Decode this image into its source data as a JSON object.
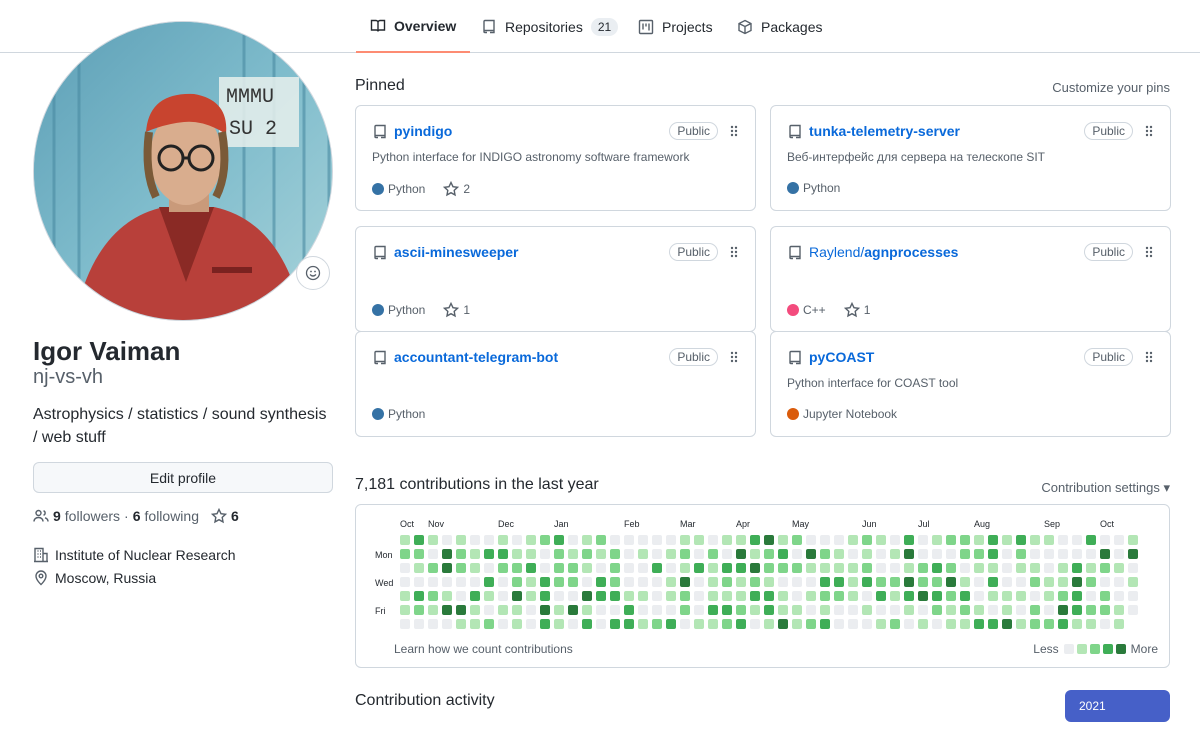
{
  "tabs": [
    {
      "label": "Overview",
      "icon": "book-icon",
      "active": true
    },
    {
      "label": "Repositories",
      "icon": "repo-icon",
      "count": "21"
    },
    {
      "label": "Projects",
      "icon": "project-icon"
    },
    {
      "label": "Packages",
      "icon": "package-icon"
    }
  ],
  "profile": {
    "name": "Igor Vaiman",
    "login": "nj-vs-vh",
    "bio": "Astrophysics / statistics / sound synthesis / web stuff",
    "edit_label": "Edit profile",
    "followers_count": "9",
    "followers_label": "followers",
    "separator": "·",
    "following_count": "6",
    "following_label": "following",
    "stars_count": "6",
    "organization": "Institute of Nuclear Research",
    "location": "Moscow, Russia"
  },
  "pinned": {
    "title": "Pinned",
    "customize": "Customize your pins",
    "cards": [
      {
        "owner": "",
        "name": "pyindigo",
        "badge": "Public",
        "desc": "Python interface for INDIGO astronomy software framework",
        "lang": "Python",
        "lang_color": "#3572A5",
        "stars": "2"
      },
      {
        "owner": "",
        "name": "tunka-telemetry-server",
        "badge": "Public",
        "desc": "Веб-интерфейс для сервера на телескопе SIT",
        "lang": "Python",
        "lang_color": "#3572A5",
        "stars": ""
      },
      {
        "owner": "",
        "name": "ascii-minesweeper",
        "badge": "Public",
        "desc": "",
        "lang": "Python",
        "lang_color": "#3572A5",
        "stars": "1"
      },
      {
        "owner": "Raylend/",
        "name": "agnprocesses",
        "badge": "Public",
        "desc": "",
        "lang": "C++",
        "lang_color": "#f34b7d",
        "stars": "1"
      },
      {
        "owner": "",
        "name": "accountant-telegram-bot",
        "badge": "Public",
        "desc": "",
        "lang": "Python",
        "lang_color": "#3572A5",
        "stars": ""
      },
      {
        "owner": "",
        "name": "pyCOAST",
        "badge": "Public",
        "desc": "Python interface for COAST tool",
        "lang": "Jupyter Notebook",
        "lang_color": "#DA5B0B",
        "stars": ""
      }
    ]
  },
  "contributions": {
    "title": "7,181 contributions in the last year",
    "settings": "Contribution settings ▾",
    "months": [
      "Oct",
      "Nov",
      "Dec",
      "Jan",
      "Feb",
      "Mar",
      "Apr",
      "May",
      "Jun",
      "Jul",
      "Aug",
      "Sep",
      "Oct"
    ],
    "month_week_index": [
      0,
      2,
      7,
      11,
      16,
      20,
      24,
      28,
      33,
      37,
      41,
      46,
      50
    ],
    "days": [
      "Mon",
      "Wed",
      "Fri"
    ],
    "learn": "Learn how we count contributions",
    "less": "Less",
    "more": "More",
    "colors": [
      "#ebedf0",
      "#9be9a8",
      "#40c463",
      "#30a14e",
      "#216e39"
    ],
    "graph_colors": [
      "#ebedf0",
      "#b3e6b5",
      "#7fd58a",
      "#3fae57",
      "#2a7a3b"
    ]
  },
  "activity": {
    "title": "Contribution activity",
    "year": "2021"
  }
}
